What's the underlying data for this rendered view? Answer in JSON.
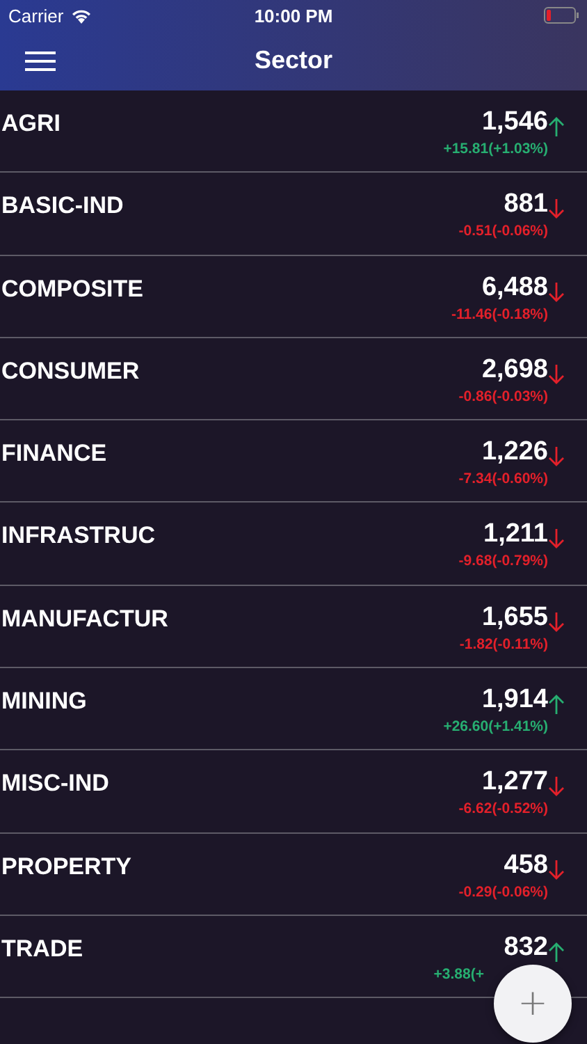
{
  "status_bar": {
    "carrier": "Carrier",
    "time": "10:00 PM"
  },
  "nav": {
    "title": "Sector"
  },
  "sectors": [
    {
      "name": "AGRI",
      "value": "1,546",
      "change": "+15.81(+1.03%)",
      "rising": true
    },
    {
      "name": "BASIC-IND",
      "value": "881",
      "change": "-0.51(-0.06%)",
      "rising": false
    },
    {
      "name": "COMPOSITE",
      "value": "6,488",
      "change": "-11.46(-0.18%)",
      "rising": false
    },
    {
      "name": "CONSUMER",
      "value": "2,698",
      "change": "-0.86(-0.03%)",
      "rising": false
    },
    {
      "name": "FINANCE",
      "value": "1,226",
      "change": "-7.34(-0.60%)",
      "rising": false
    },
    {
      "name": "INFRASTRUC",
      "value": "1,211",
      "change": "-9.68(-0.79%)",
      "rising": false
    },
    {
      "name": "MANUFACTUR",
      "value": "1,655",
      "change": "-1.82(-0.11%)",
      "rising": false
    },
    {
      "name": "MINING",
      "value": "1,914",
      "change": "+26.60(+1.41%)",
      "rising": true
    },
    {
      "name": "MISC-IND",
      "value": "1,277",
      "change": "-6.62(-0.52%)",
      "rising": false
    },
    {
      "name": "PROPERTY",
      "value": "458",
      "change": "-0.29(-0.06%)",
      "rising": false
    },
    {
      "name": "TRADE",
      "value": "832",
      "change": "+3.88(+",
      "rising": true
    }
  ],
  "fab": {
    "label": "+"
  }
}
